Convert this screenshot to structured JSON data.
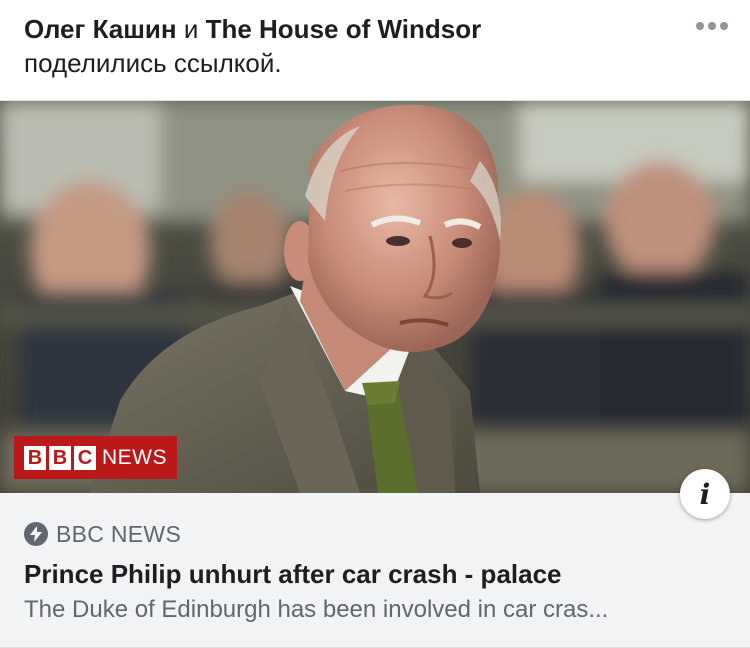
{
  "post": {
    "actor1": "Олег Кашин",
    "conjunction": "и",
    "actor2": "The House of Windsor",
    "action_text": "поделились ссылкой.",
    "more_icon": "more-horizontal-icon"
  },
  "link_card": {
    "image_alt": "Prince Philip",
    "bbc_letters": [
      "B",
      "B",
      "C"
    ],
    "bbc_news_word": "NEWS",
    "info_icon_glyph": "i",
    "source_icon": "lightning-bolt-icon",
    "source": "BBC NEWS",
    "title": "Prince Philip unhurt after car crash - palace",
    "description": "The Duke of Edinburgh has been involved in car cras..."
  },
  "colors": {
    "bbc_red": "#bb1919",
    "secondary_text": "#606770",
    "card_background": "#f2f3f5"
  }
}
